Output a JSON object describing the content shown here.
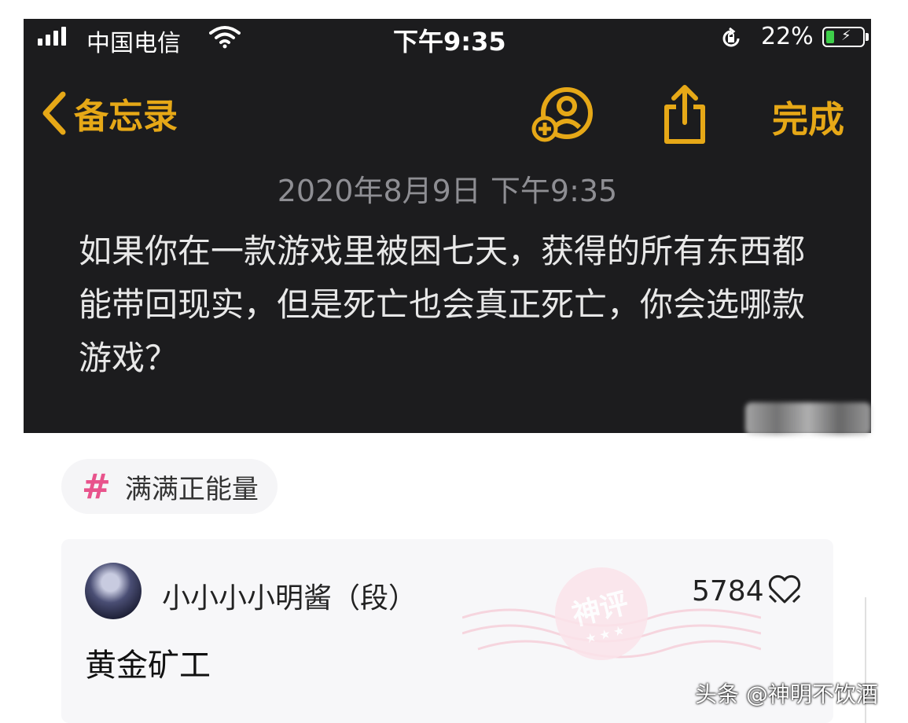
{
  "status_bar": {
    "carrier": "中国电信",
    "time": "下午9:35",
    "battery": "22%",
    "battery_level": 0.22,
    "signal_icon": "signal-icon",
    "wifi_icon": "wifi-icon"
  },
  "nav": {
    "back_label": "备忘录",
    "done_label": "完成",
    "add_icon": "add-person-icon",
    "share_icon": "share-icon"
  },
  "note": {
    "date": "2020年8月9日 下午9:35",
    "body": "如果你在一款游戏里被困七天，获得的所有东西都能带回现实，但是死亡也会真正死亡，你会选哪款游戏？"
  },
  "tag": {
    "label": "满满正能量"
  },
  "comment": {
    "author": "小小小小明酱（段）",
    "likes": "5784",
    "text": "黄金矿工",
    "badge": "神评",
    "badge_stars": "★★★"
  },
  "watermark": {
    "text": "头条 @神明不饮酒"
  },
  "colors": {
    "accent": "#e6a817",
    "dark_bg": "#1c1c1e",
    "tag_hash": "#e8538c"
  }
}
